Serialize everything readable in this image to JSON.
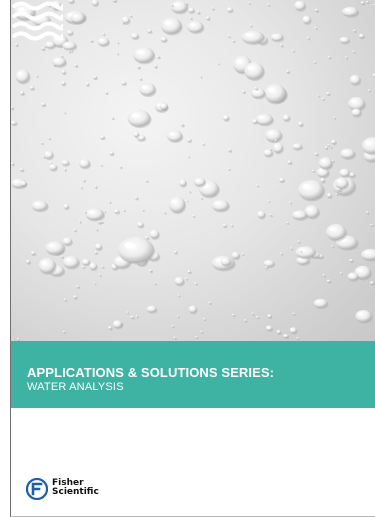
{
  "banner": {
    "title": "APPLICATIONS & SOLUTIONS SERIES:",
    "subtitle": "WATER ANALYSIS",
    "color": "#3eb3a4"
  },
  "cover_image": {
    "subject": "water droplets on a white surface"
  },
  "logo": {
    "line1": "Fisher",
    "line2": "Scientific",
    "icon": "fisher-scientific-logo-icon"
  },
  "decor": {
    "icon": "water-waves-icon"
  }
}
